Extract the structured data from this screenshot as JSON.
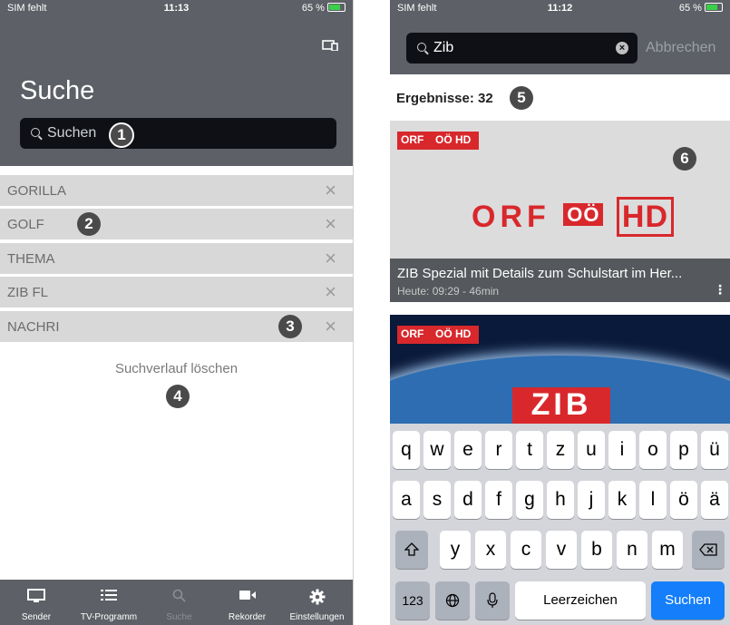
{
  "left": {
    "status": {
      "carrier": "SIM fehlt",
      "time": "11:13",
      "battery": "65 %"
    },
    "title": "Suche",
    "search_placeholder": "Suchen",
    "history": [
      {
        "label": "GORILLA"
      },
      {
        "label": "GOLF"
      },
      {
        "label": "THEMA"
      },
      {
        "label": "ZIB FL"
      },
      {
        "label": "NACHRI"
      }
    ],
    "clear_history": "Suchverlauf löschen",
    "tabs": [
      {
        "label": "Sender",
        "icon": "tv-icon"
      },
      {
        "label": "TV-Programm",
        "icon": "list-icon"
      },
      {
        "label": "Suche",
        "icon": "search-icon"
      },
      {
        "label": "Rekorder",
        "icon": "camera-icon"
      },
      {
        "label": "Einstellungen",
        "icon": "gear-icon"
      }
    ]
  },
  "right": {
    "status": {
      "carrier": "SIM fehlt",
      "time": "11:12",
      "battery": "65 %"
    },
    "search_value": "Zib",
    "cancel": "Abbrechen",
    "results": "Ergebnisse: 32",
    "card1": {
      "channel_small": "ORF",
      "channel_sub": "OÖ",
      "hd": "HD",
      "title": "ZIB Spezial mit Details zum Schulstart im Her...",
      "time": "Heute: 09:29 - 46min"
    },
    "card2": {
      "channel_small": "ORF",
      "channel_sub": "OÖ",
      "hd": "HD",
      "logo": "ZIB"
    },
    "keyboard": {
      "row1": [
        "q",
        "w",
        "e",
        "r",
        "t",
        "z",
        "u",
        "i",
        "o",
        "p",
        "ü"
      ],
      "row2": [
        "a",
        "s",
        "d",
        "f",
        "g",
        "h",
        "j",
        "k",
        "l",
        "ö",
        "ä"
      ],
      "row3": [
        "y",
        "x",
        "c",
        "v",
        "b",
        "n",
        "m"
      ],
      "numbers": "123",
      "space": "Leerzeichen",
      "submit": "Suchen"
    }
  },
  "badges": [
    "1",
    "2",
    "3",
    "4",
    "5",
    "6"
  ],
  "colors": {
    "header": "#5d6066",
    "accent_red": "#d8282c",
    "key_blue": "#147efb"
  }
}
